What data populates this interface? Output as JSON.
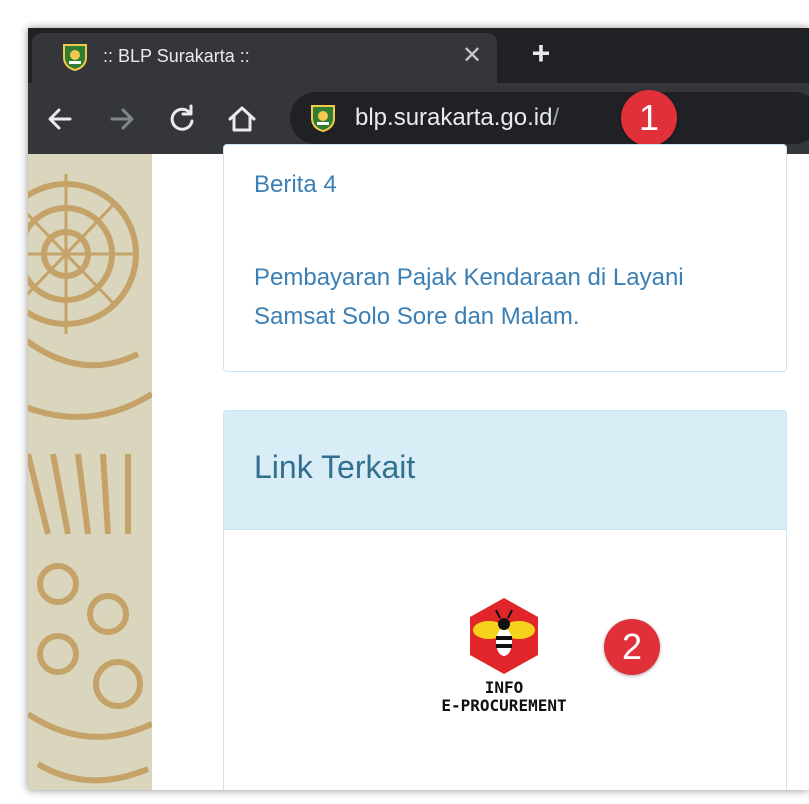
{
  "browser": {
    "tab_title": ":: BLP Surakarta ::",
    "tab_close_glyph": "✕",
    "new_tab_glyph": "+",
    "url_host": "blp.surakarta.go.id",
    "url_path": "/"
  },
  "page": {
    "news_items": [
      "Berita 4",
      "Pembayaran Pajak Kendaraan di Layani",
      "Samsat Solo Sore dan Malam."
    ],
    "link_section_title": "Link Terkait",
    "eproc_line1": "INFO",
    "eproc_line2": "E-PROCUREMENT"
  },
  "annotations": {
    "badge1": "1",
    "badge2": "2"
  },
  "colors": {
    "tabstrip": "#202124",
    "toolbar": "#35363a",
    "link": "#3a7fb5",
    "panel_header": "#d9edf7",
    "badge": "#e0303a",
    "eproc_hex": "#e0262a",
    "bee_yellow": "#f6d21c"
  },
  "icons": [
    "site-favicon-icon",
    "close-icon",
    "plus-icon",
    "back-arrow-icon",
    "forward-arrow-icon",
    "reload-icon",
    "home-icon",
    "bee-icon"
  ]
}
